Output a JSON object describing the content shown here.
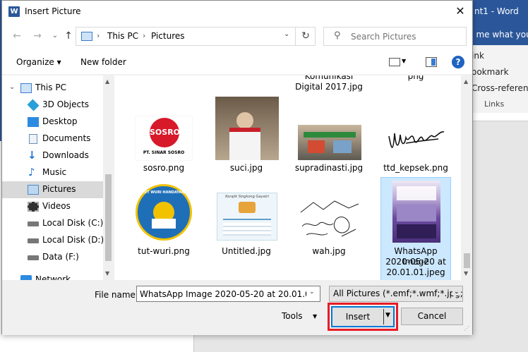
{
  "word": {
    "title": "nt1 - Word",
    "tell_me": "ll me what you",
    "ribbon": [
      "ink",
      "ookmark",
      "Cross-reference"
    ],
    "group_label": "Links"
  },
  "dialog": {
    "title": "Insert Picture",
    "close_glyph": "✕",
    "app_icon_letter": "W"
  },
  "nav": {
    "back": "←",
    "forward": "→",
    "recent": "⌄",
    "up": "↑",
    "refresh": "↻"
  },
  "address": {
    "crumbs": [
      "This PC",
      "Pictures"
    ],
    "separator": "›",
    "dropdown": "⌄"
  },
  "search": {
    "placeholder": "Search Pictures",
    "icon": "⚲"
  },
  "toolbar": {
    "organize": "Organize ▾",
    "new_folder": "New folder",
    "view_dd": "▼",
    "help": "?"
  },
  "sidebar": {
    "items": [
      {
        "label": "This PC",
        "icon": "pc-icon",
        "color": "#3d7bc7"
      },
      {
        "label": "3D Objects",
        "icon": "cube-icon",
        "color": "#2aa0d8"
      },
      {
        "label": "Desktop",
        "icon": "desktop-icon",
        "color": "#2c8be0"
      },
      {
        "label": "Documents",
        "icon": "document-icon",
        "color": "#6b8fb5"
      },
      {
        "label": "Downloads",
        "icon": "download-icon",
        "color": "#1f73d1"
      },
      {
        "label": "Music",
        "icon": "music-icon",
        "color": "#1f73d1"
      },
      {
        "label": "Pictures",
        "icon": "pictures-icon",
        "color": "#4a8bc9"
      },
      {
        "label": "Videos",
        "icon": "video-icon",
        "color": "#333333"
      },
      {
        "label": "Local Disk (C:)",
        "icon": "drive-icon",
        "color": "#777777"
      },
      {
        "label": "Local Disk (D:)",
        "icon": "drive-icon",
        "color": "#777777"
      },
      {
        "label": "Data (F:)",
        "icon": "drive-icon",
        "color": "#777777"
      },
      {
        "label": "Network",
        "icon": "network-icon",
        "color": "#2c8be0"
      }
    ],
    "selected": "Pictures"
  },
  "files": {
    "top_partial": [
      {
        "label_line1": "Komunikasi",
        "label_line2": "Digital 2017.jpg"
      },
      {
        "label_line1": "png",
        "label_line2": ""
      }
    ],
    "row1": [
      {
        "name": "sosro.png",
        "logo_text": "SOSRO",
        "sub_text": "PT. SINAR SOSRO"
      },
      {
        "name": "suci.jpg"
      },
      {
        "name": "supradinasti.jpg"
      },
      {
        "name": "ttd_kepsek.png"
      }
    ],
    "row2": [
      {
        "name": "tut-wuri.png",
        "logo_text": "TUT WURI HANDAYANI"
      },
      {
        "name": "Untitled.jpg",
        "doc_title": "Kerajik Singkong Gayatri"
      },
      {
        "name": "wah.jpg"
      },
      {
        "name_line1": "WhatsApp Image",
        "name_line2": "2020-05-20 at",
        "name_line3": "20.01.01.jpeg"
      }
    ]
  },
  "footer": {
    "filename_label": "File name:",
    "filename_value": "WhatsApp Image 2020-05-20 at 20.01.01.jpeg",
    "filter": "All Pictures (*.emf;*.wmf;*.jpg;*",
    "dd": "⌄",
    "tools": "Tools",
    "tools_dd": "▼",
    "insert": "Insert",
    "insert_dd": "▼",
    "cancel": "Cancel",
    "highlight_color": "#e81c24"
  },
  "scroll": {
    "up": "▲",
    "down": "▼"
  }
}
